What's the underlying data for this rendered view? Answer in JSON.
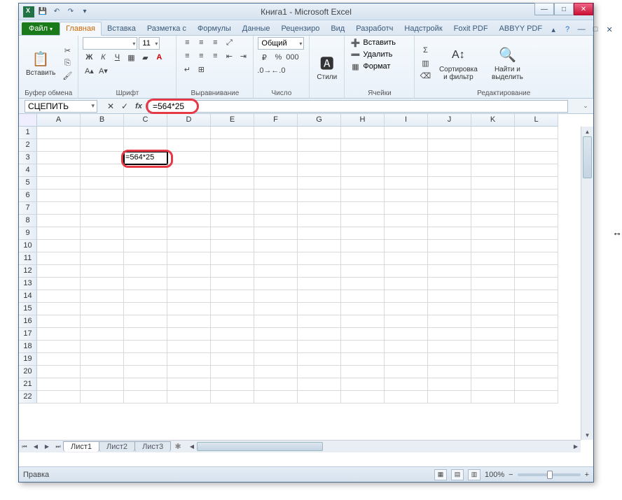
{
  "window": {
    "title": "Книга1 - Microsoft Excel"
  },
  "tabs": {
    "file": "Файл",
    "items": [
      "Главная",
      "Вставка",
      "Разметка с",
      "Формулы",
      "Данные",
      "Рецензиро",
      "Вид",
      "Разработч",
      "Надстройк",
      "Foxit PDF",
      "ABBYY PDF"
    ],
    "active_index": 0
  },
  "ribbon": {
    "clipboard": {
      "paste": "Вставить",
      "label": "Буфер обмена"
    },
    "font": {
      "name": "",
      "size": "11",
      "label": "Шрифт"
    },
    "alignment": {
      "label": "Выравнивание"
    },
    "number": {
      "format": "Общий",
      "label": "Число"
    },
    "styles": {
      "btn": "Стили",
      "label": ""
    },
    "cells": {
      "insert": "Вставить",
      "delete": "Удалить",
      "format": "Формат",
      "label": "Ячейки"
    },
    "editing": {
      "sort": "Сортировка и фильтр",
      "find": "Найти и выделить",
      "label": "Редактирование"
    }
  },
  "formula_bar": {
    "name_box": "СЦЕПИТЬ",
    "formula": "=564*25"
  },
  "grid": {
    "columns": [
      "A",
      "B",
      "C",
      "D",
      "E",
      "F",
      "G",
      "H",
      "I",
      "J",
      "K",
      "L"
    ],
    "row_count": 22,
    "active_cell": {
      "row": 3,
      "col": "C",
      "value": "=564*25"
    }
  },
  "sheets": {
    "tabs": [
      "Лист1",
      "Лист2",
      "Лист3"
    ],
    "active_index": 0
  },
  "status": {
    "mode": "Правка",
    "zoom": "100%"
  }
}
